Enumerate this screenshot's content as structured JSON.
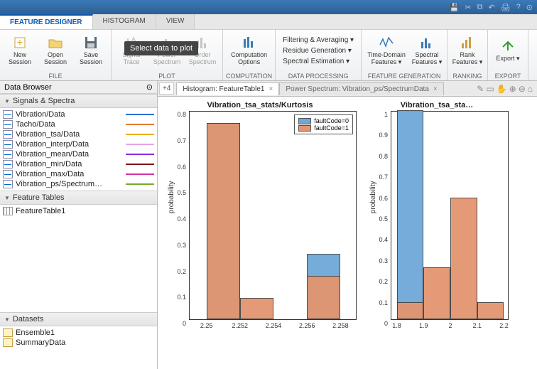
{
  "titlebar_icons": [
    "save",
    "cut",
    "copy",
    "paste",
    "undo",
    "print",
    "help"
  ],
  "app_tabs": [
    "FEATURE DESIGNER",
    "HISTOGRAM",
    "VIEW"
  ],
  "active_app_tab": 0,
  "ribbon": {
    "file": {
      "label": "FILE",
      "buttons": [
        {
          "name": "new-session",
          "label": "New\nSession"
        },
        {
          "name": "open-session",
          "label": "Open\nSession"
        },
        {
          "name": "save-session",
          "label": "Save\nSession"
        }
      ]
    },
    "plot": {
      "label": "PLOT",
      "buttons": [
        {
          "name": "signal-trace",
          "label": "Signal\nTrace"
        },
        {
          "name": "power-spectrum",
          "label": "Power\nSpectrum"
        },
        {
          "name": "order-spectrum",
          "label": "Order\nSpectrum"
        }
      ],
      "tooltip": "Select data to plot"
    },
    "computation": {
      "label": "COMPUTATION",
      "buttons": [
        {
          "name": "computation-options",
          "label": "Computation\nOptions"
        }
      ]
    },
    "dataproc": {
      "label": "DATA PROCESSING",
      "items": [
        "Filtering & Averaging ▾",
        "Residue Generation ▾",
        "Spectral Estimation ▾"
      ]
    },
    "featgen": {
      "label": "FEATURE GENERATION",
      "buttons": [
        {
          "name": "time-domain-features",
          "label": "Time-Domain\nFeatures ▾"
        },
        {
          "name": "spectral-features",
          "label": "Spectral\nFeatures ▾"
        }
      ]
    },
    "ranking": {
      "label": "RANKING",
      "buttons": [
        {
          "name": "rank-features",
          "label": "Rank\nFeatures ▾"
        }
      ]
    },
    "export": {
      "label": "EXPORT",
      "buttons": [
        {
          "name": "export",
          "label": "Export\n▾"
        }
      ]
    }
  },
  "data_browser_label": "Data Browser",
  "signals_panel": "Signals & Spectra",
  "signals": [
    {
      "label": "Vibration/Data",
      "color": "#2a6fd6"
    },
    {
      "label": "Tacho/Data",
      "color": "#e8762d"
    },
    {
      "label": "Vibration_tsa/Data",
      "color": "#f0b000"
    },
    {
      "label": "Vibration_interp/Data",
      "color": "#e6a5e6"
    },
    {
      "label": "Vibration_mean/Data",
      "color": "#8a2be2"
    },
    {
      "label": "Vibration_min/Data",
      "color": "#7b1616"
    },
    {
      "label": "Vibration_max/Data",
      "color": "#d62ea8"
    },
    {
      "label": "Vibration_ps/Spectrum…",
      "color": "#6fae2b"
    }
  ],
  "feature_tables_panel": "Feature Tables",
  "feature_tables": [
    "FeatureTable1"
  ],
  "datasets_panel": "Datasets",
  "datasets": [
    "Ensemble1",
    "SummaryData"
  ],
  "doc_tabs": [
    {
      "label": "Histogram: FeatureTable1",
      "active": true
    },
    {
      "label": "Power Spectrum: Vibration_ps/SpectrumData",
      "active": false
    }
  ],
  "plus_label": "+4",
  "legend_items": [
    {
      "label": "faultCode=0",
      "color": "#6fa8d8"
    },
    {
      "label": "faultCode=1",
      "color": "#e3956f"
    }
  ],
  "chart_data": [
    {
      "type": "bar",
      "title": "Vibration_tsa_stats/Kurtosis",
      "xlabel": "",
      "ylabel": "probability",
      "ylim": [
        0,
        0.8
      ],
      "yticks": [
        0,
        0.1,
        0.2,
        0.3,
        0.4,
        0.5,
        0.6,
        0.7,
        0.8
      ],
      "xlim": [
        2.249,
        2.259
      ],
      "xticks": [
        2.25,
        2.252,
        2.254,
        2.256,
        2.258
      ],
      "bin_edges": [
        2.25,
        2.252,
        2.254,
        2.256,
        2.258
      ],
      "series": [
        {
          "name": "faultCode=0",
          "color": "#6fa8d8",
          "values": [
            0.75,
            0.0,
            0.0,
            0.25
          ]
        },
        {
          "name": "faultCode=1",
          "color": "#e3956f",
          "values": [
            0.75,
            0.083,
            0.0,
            0.167
          ]
        }
      ]
    },
    {
      "type": "bar",
      "title": "Vibration_tsa_sta…",
      "xlabel": "",
      "ylabel": "probability",
      "ylim": [
        0,
        1
      ],
      "yticks": [
        0,
        0.1,
        0.2,
        0.3,
        0.4,
        0.5,
        0.6,
        0.7,
        0.8,
        0.9,
        1
      ],
      "xlim": [
        1.78,
        2.22
      ],
      "xticks": [
        1.8,
        1.9,
        2,
        2.1,
        2.2
      ],
      "bin_edges": [
        1.8,
        1.9,
        2.0,
        2.1,
        2.2
      ],
      "series": [
        {
          "name": "faultCode=0",
          "color": "#6fa8d8",
          "values": [
            1.0,
            0.0,
            0.0,
            0.0
          ]
        },
        {
          "name": "faultCode=1",
          "color": "#e3956f",
          "values": [
            0.083,
            0.25,
            0.583,
            0.083
          ]
        }
      ]
    }
  ]
}
